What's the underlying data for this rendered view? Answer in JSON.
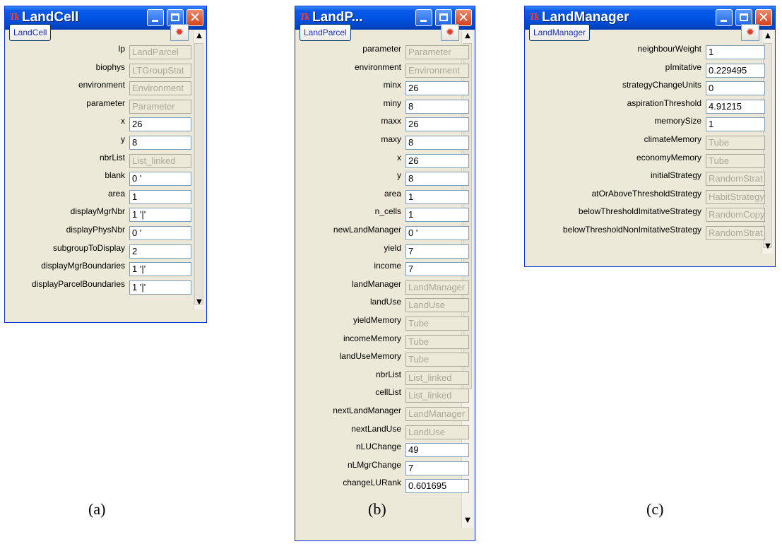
{
  "windows": [
    {
      "id": "a",
      "title": "LandCell",
      "logo": "Tk",
      "class_button": "LandCell",
      "caption": "(a)",
      "fields": [
        {
          "label": "lp",
          "value": "LandParcel",
          "readonly": true
        },
        {
          "label": "biophys",
          "value": "LTGroupStat",
          "readonly": true
        },
        {
          "label": "environment",
          "value": "Environment",
          "readonly": true
        },
        {
          "label": "parameter",
          "value": "Parameter",
          "readonly": true
        },
        {
          "label": "x",
          "value": "26",
          "readonly": false
        },
        {
          "label": "y",
          "value": "8",
          "readonly": false
        },
        {
          "label": "nbrList",
          "value": "List_linked",
          "readonly": true
        },
        {
          "label": "blank",
          "value": "0 '",
          "readonly": false
        },
        {
          "label": "area",
          "value": "1",
          "readonly": false
        },
        {
          "label": "displayMgrNbr",
          "value": "1 '|'",
          "readonly": false
        },
        {
          "label": "displayPhysNbr",
          "value": "0 '",
          "readonly": false
        },
        {
          "label": "subgroupToDisplay",
          "value": "2",
          "readonly": false
        },
        {
          "label": "displayMgrBoundaries",
          "value": "1 '|'",
          "readonly": false
        },
        {
          "label": "displayParcelBoundaries",
          "value": "1 '|'",
          "readonly": false
        }
      ]
    },
    {
      "id": "b",
      "title": "LandP...",
      "logo": "Tk",
      "class_button": "LandParcel",
      "caption": "(b)",
      "fields": [
        {
          "label": "parameter",
          "value": "Parameter",
          "readonly": true
        },
        {
          "label": "environment",
          "value": "Environment",
          "readonly": true
        },
        {
          "label": "minx",
          "value": "26",
          "readonly": false
        },
        {
          "label": "miny",
          "value": "8",
          "readonly": false
        },
        {
          "label": "maxx",
          "value": "26",
          "readonly": false
        },
        {
          "label": "maxy",
          "value": "8",
          "readonly": false
        },
        {
          "label": "x",
          "value": "26",
          "readonly": false
        },
        {
          "label": "y",
          "value": "8",
          "readonly": false
        },
        {
          "label": "area",
          "value": "1",
          "readonly": false
        },
        {
          "label": "n_cells",
          "value": "1",
          "readonly": false
        },
        {
          "label": "newLandManager",
          "value": "0 '",
          "readonly": false
        },
        {
          "label": "yield",
          "value": "7",
          "readonly": false
        },
        {
          "label": "income",
          "value": "7",
          "readonly": false
        },
        {
          "label": "landManager",
          "value": "LandManager",
          "readonly": true
        },
        {
          "label": "landUse",
          "value": "LandUse",
          "readonly": true
        },
        {
          "label": "yieldMemory",
          "value": "Tube",
          "readonly": true
        },
        {
          "label": "incomeMemory",
          "value": "Tube",
          "readonly": true
        },
        {
          "label": "landUseMemory",
          "value": "Tube",
          "readonly": true
        },
        {
          "label": "nbrList",
          "value": "List_linked",
          "readonly": true
        },
        {
          "label": "cellList",
          "value": "List_linked",
          "readonly": true
        },
        {
          "label": "nextLandManager",
          "value": "LandManager",
          "readonly": true
        },
        {
          "label": "nextLandUse",
          "value": "LandUse",
          "readonly": true
        },
        {
          "label": "nLUChange",
          "value": "49",
          "readonly": false
        },
        {
          "label": "nLMgrChange",
          "value": "7",
          "readonly": false
        },
        {
          "label": "changeLURank",
          "value": "0.601695",
          "readonly": false
        }
      ]
    },
    {
      "id": "c",
      "title": "LandManager",
      "logo": "Tk",
      "class_button": "LandManager",
      "caption": "(c)",
      "fields": [
        {
          "label": "neighbourWeight",
          "value": "1",
          "readonly": false
        },
        {
          "label": "pImitative",
          "value": "0.229495",
          "readonly": false
        },
        {
          "label": "strategyChangeUnits",
          "value": "0",
          "readonly": false
        },
        {
          "label": "aspirationThreshold",
          "value": "4.91215",
          "readonly": false
        },
        {
          "label": "memorySize",
          "value": "1",
          "readonly": false
        },
        {
          "label": "climateMemory",
          "value": "Tube",
          "readonly": true
        },
        {
          "label": "economyMemory",
          "value": "Tube",
          "readonly": true
        },
        {
          "label": "initialStrategy",
          "value": "RandomStrat",
          "readonly": true
        },
        {
          "label": "atOrAboveThresholdStrategy",
          "value": "HabitStrategy",
          "readonly": true
        },
        {
          "label": "belowThresholdImitativeStrategy",
          "value": "RandomCopy",
          "readonly": true
        },
        {
          "label": "belowThresholdNonImitativeStrategy",
          "value": "RandomStrat",
          "readonly": true
        }
      ]
    }
  ],
  "icons": {
    "minimize": "minimize-icon",
    "maximize": "maximize-icon",
    "close": "close-x-icon",
    "drop_object": "bug-icon",
    "scroll_up": "arrow-up-icon",
    "scroll_down": "arrow-down-icon"
  },
  "colors": {
    "titlebar": "#0054e3",
    "window_bg": "#ece9d8",
    "readonly_text": "#aca899",
    "class_button_text": "#1a2fb5"
  }
}
